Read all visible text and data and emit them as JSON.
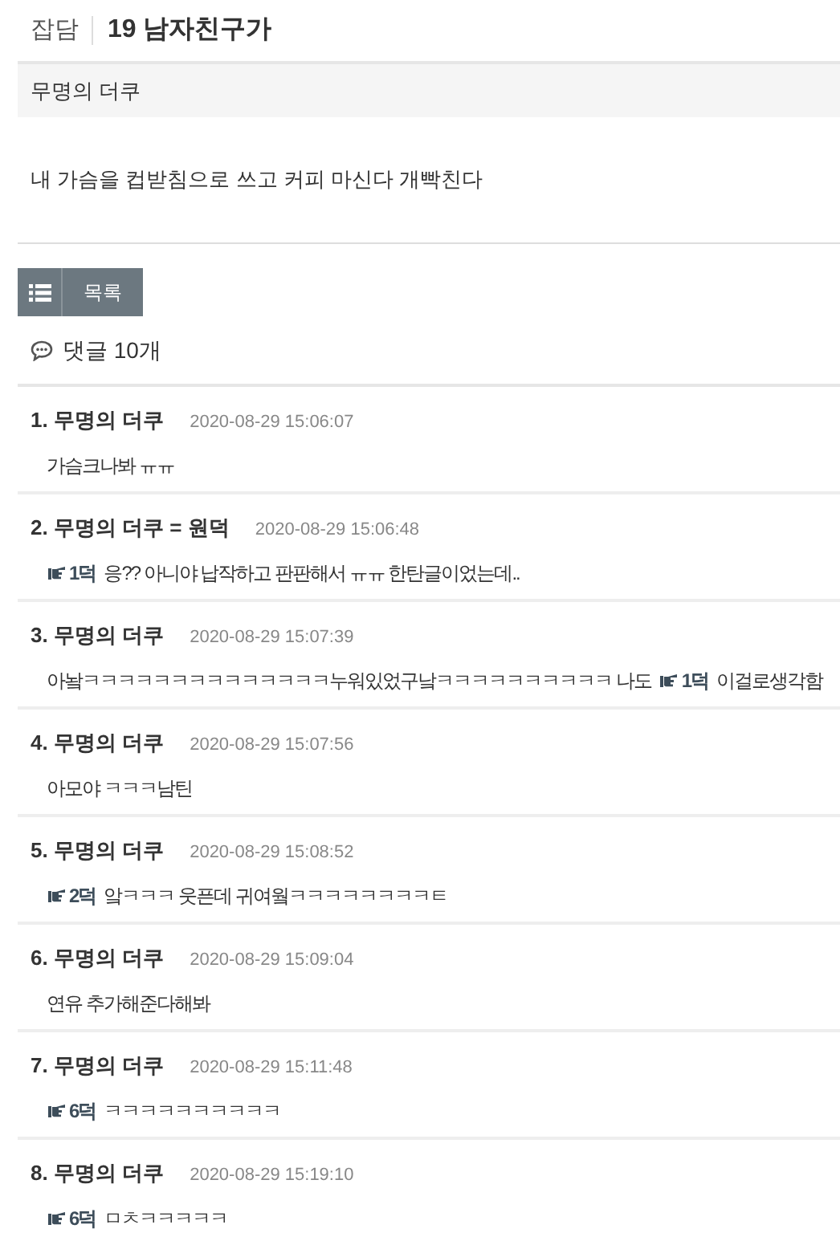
{
  "post": {
    "category": "잡담",
    "title": "19 남자친구가",
    "author": "무명의 더쿠",
    "body": "내 가슴을 컵받침으로 쓰고 커피 마신다 개빡친다"
  },
  "list_button": {
    "label": "목록"
  },
  "comments_header": {
    "label": "댓글 10개"
  },
  "comments": [
    {
      "number": "1.",
      "author": "무명의 더쿠",
      "time": "2020-08-29 15:06:07",
      "body": [
        {
          "kind": "text",
          "text": "가슴크나봐 ㅠㅠ"
        }
      ]
    },
    {
      "number": "2.",
      "author": "무명의 더쿠 = 원덕",
      "time": "2020-08-29 15:06:48",
      "body": [
        {
          "kind": "ref",
          "text": "1덕"
        },
        {
          "kind": "text",
          "text": "응?? 아니야 납작하고 판판해서 ㅠㅠ 한탄글이었는데.."
        }
      ]
    },
    {
      "number": "3.",
      "author": "무명의 더쿠",
      "time": "2020-08-29 15:07:39",
      "body": [
        {
          "kind": "text",
          "text": "아놬ㅋㅋㅋㅋㅋㅋㅋㅋㅋㅋㅋㅋㅋㅋ누워있었구낰ㅋㅋㅋㅋㅋㅋㅋㅋㅋㅋ 나도"
        },
        {
          "kind": "ref",
          "text": "1덕"
        },
        {
          "kind": "text",
          "text": "이걸로생각함"
        }
      ]
    },
    {
      "number": "4.",
      "author": "무명의 더쿠",
      "time": "2020-08-29 15:07:56",
      "body": [
        {
          "kind": "text",
          "text": "아모야 ㅋㅋㅋ남틴"
        }
      ]
    },
    {
      "number": "5.",
      "author": "무명의 더쿠",
      "time": "2020-08-29 15:08:52",
      "body": [
        {
          "kind": "ref",
          "text": "2덕"
        },
        {
          "kind": "text",
          "text": "앜ㅋㅋㅋ 웃픈데 귀여웤ㅋㅋㅋㅋㅋㅋㅋㅋㅌ"
        }
      ]
    },
    {
      "number": "6.",
      "author": "무명의 더쿠",
      "time": "2020-08-29 15:09:04",
      "body": [
        {
          "kind": "text",
          "text": "연유 추가해준다해봐"
        }
      ]
    },
    {
      "number": "7.",
      "author": "무명의 더쿠",
      "time": "2020-08-29 15:11:48",
      "body": [
        {
          "kind": "ref",
          "text": "6덕"
        },
        {
          "kind": "text",
          "text": "ㅋㅋㅋㅋㅋㅋㅋㅋㅋㅋ"
        }
      ]
    },
    {
      "number": "8.",
      "author": "무명의 더쿠",
      "time": "2020-08-29 15:19:10",
      "body": [
        {
          "kind": "ref",
          "text": "6덕"
        },
        {
          "kind": "text",
          "text": "ㅁㅊㅋㅋㅋㅋㅋ"
        }
      ]
    }
  ]
}
